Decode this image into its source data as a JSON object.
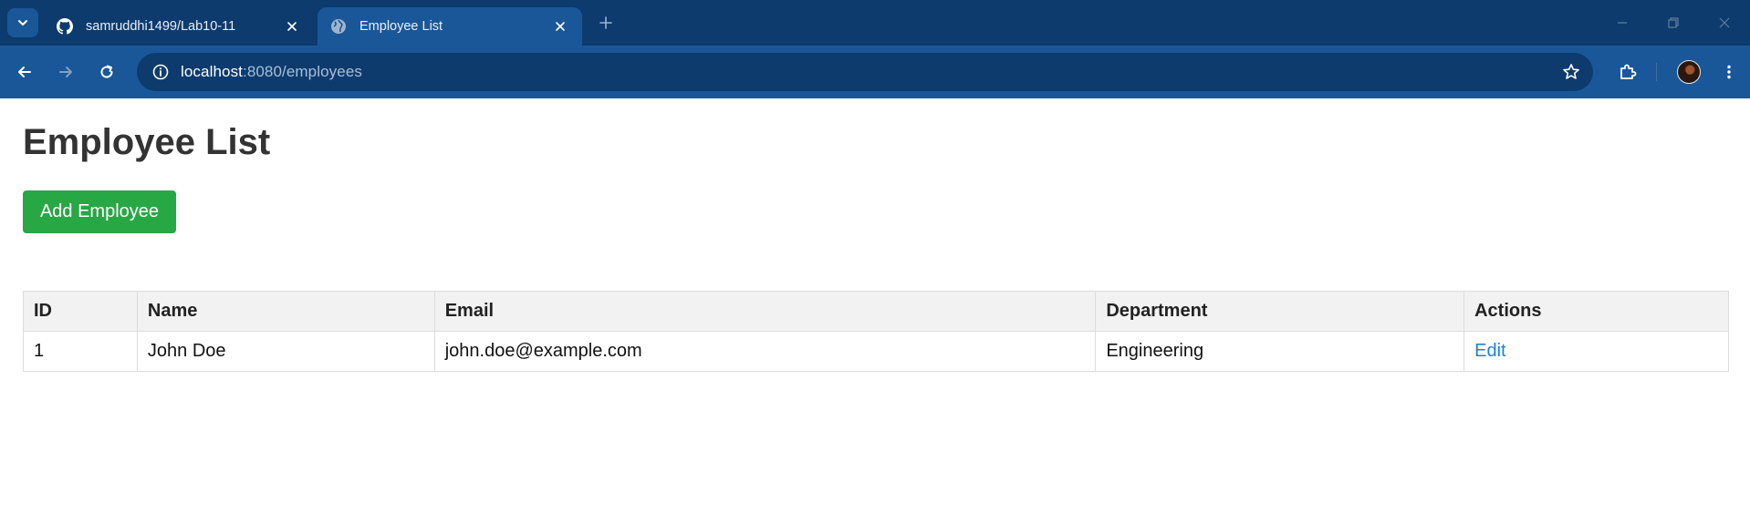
{
  "browser": {
    "tabs": [
      {
        "title": "samruddhi1499/Lab10-11",
        "favicon": "github-icon",
        "active": false
      },
      {
        "title": "Employee List",
        "favicon": "globe-icon",
        "active": true
      }
    ],
    "url_host": "localhost",
    "url_path": ":8080/employees"
  },
  "page": {
    "title": "Employee List",
    "add_button_label": "Add Employee",
    "table": {
      "columns": [
        "ID",
        "Name",
        "Email",
        "Department",
        "Actions"
      ],
      "rows": [
        {
          "id": "1",
          "name": "John Doe",
          "email": "john.doe@example.com",
          "department": "Engineering",
          "action": "Edit"
        }
      ]
    }
  },
  "colors": {
    "tab_strip": "#0d3b6e",
    "toolbar": "#1a5799",
    "add_button": "#28a745",
    "link": "#1e7fe0"
  }
}
